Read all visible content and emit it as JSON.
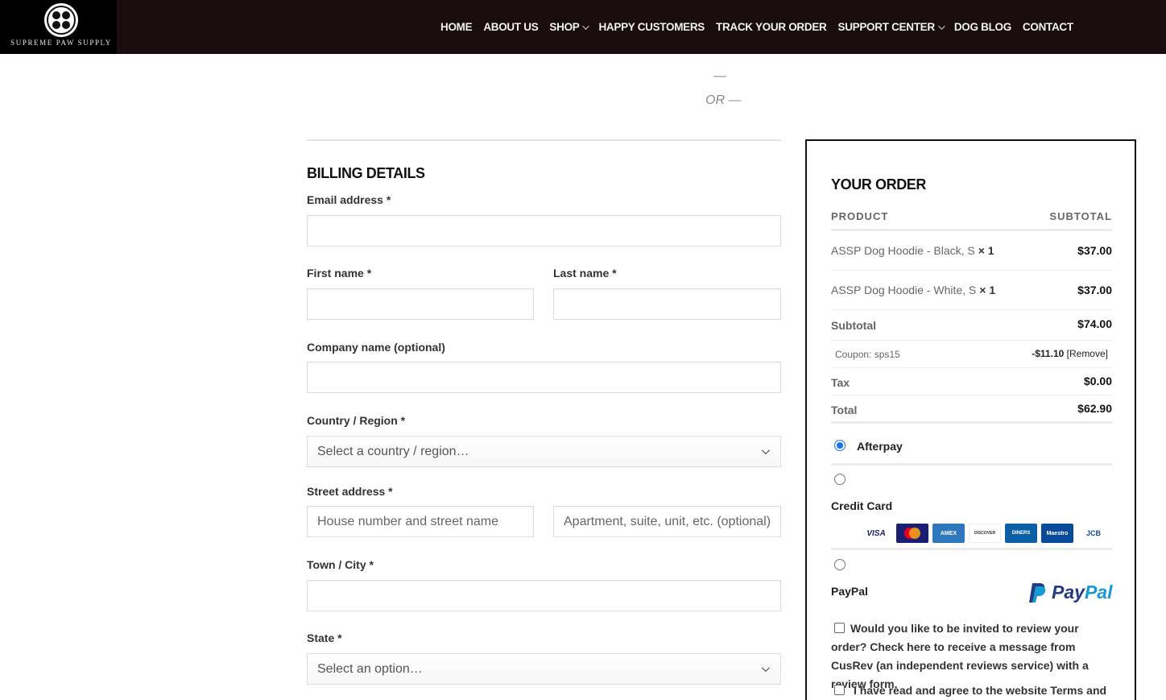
{
  "brand": {
    "logo_text": "SUPREME PAW SUPPLY"
  },
  "nav": {
    "items": [
      {
        "label": "HOME"
      },
      {
        "label": "ABOUT US"
      },
      {
        "label": "SHOP"
      },
      {
        "label": "HAPPY CUSTOMERS"
      },
      {
        "label": "TRACK YOUR ORDER"
      },
      {
        "label": "SUPPORT CENTER"
      },
      {
        "label": "DOG BLOG"
      },
      {
        "label": "CONTACT"
      }
    ]
  },
  "separator": {
    "dash": "—",
    "or": "OR —"
  },
  "billing": {
    "title": "BILLING DETAILS",
    "email_label": "Email address *",
    "first_name_label": "First name *",
    "last_name_label": "Last name *",
    "company_label": "Company name (optional)",
    "country_label": "Country / Region *",
    "country_value": "Select a country / region…",
    "street_label": "Street address *",
    "street_placeholder": "House number and street name",
    "street2_placeholder": "Apartment, suite, unit, etc. (optional)",
    "city_label": "Town / City *",
    "state_label": "State *",
    "state_value": "Select an option…"
  },
  "order": {
    "title": "YOUR ORDER",
    "col_product": "PRODUCT",
    "col_subtotal": "SUBTOTAL",
    "items": [
      {
        "name": "ASSP Dog Hoodie - Black, S",
        "qty": "× 1",
        "price": "$37.00"
      },
      {
        "name": "ASSP Dog Hoodie - White, S",
        "qty": "× 1",
        "price": "$37.00"
      }
    ],
    "subtotal_label": "Subtotal",
    "subtotal_value": "$74.00",
    "coupon_label": "Coupon: sps15",
    "coupon_value": "-$11.10",
    "coupon_remove": "[Remove]",
    "tax_label": "Tax",
    "tax_value": "$0.00",
    "total_label": "Total",
    "total_value": "$62.90"
  },
  "payment": {
    "afterpay_label": "Afterpay",
    "credit_card_label": "Credit Card",
    "cards": [
      "VISA",
      "MC",
      "AMEX",
      "DISCOVER",
      "DINERS",
      "Maestro",
      "JCB"
    ],
    "paypal_label": "PayPal",
    "paypal_logo_1": "Pay",
    "paypal_logo_2": "Pal",
    "selected": "afterpay"
  },
  "review_opt_in": "Would you like to be invited to review your order? Check here to receive a message from CusRev (an independent reviews service) with a review form.",
  "terms_text": "I have read and agree to the website Terms and"
}
